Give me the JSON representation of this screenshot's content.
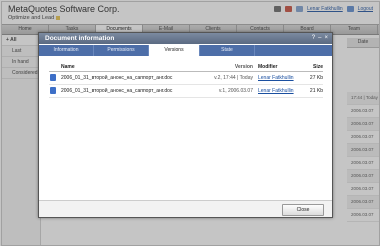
{
  "header": {
    "app_title": "MetaQuotes Software Corp.",
    "subtitle": "Optimize and Lead",
    "user_link": "Lenar Fatkhullin",
    "logout_link": "Logout"
  },
  "tabs": [
    "Home",
    "Tasks",
    "Documents",
    "E-Mail",
    "Clients",
    "Contacts",
    "Board",
    "Team"
  ],
  "active_tab": "Documents",
  "sidebar": {
    "items": [
      {
        "label": "All"
      },
      {
        "label": "Last"
      },
      {
        "label": "In hand"
      },
      {
        "label": "Considered"
      }
    ]
  },
  "background_list": {
    "column_header": "Date",
    "dates": [
      "17:44 | Today",
      "2006.03.07",
      "2006.03.07",
      "2006.03.07",
      "2006.03.07",
      "2006.03.07",
      "2006.03.07",
      "2006.03.07",
      "2006.03.07",
      "2006.03.07"
    ]
  },
  "modal": {
    "title": "Document information",
    "tabs": [
      "Information",
      "Permissions",
      "Versions",
      "State"
    ],
    "active_tab": "Versions",
    "columns": {
      "name": "Name",
      "version": "Version",
      "modifier": "Modifier",
      "size": "Size"
    },
    "rows": [
      {
        "name": "2006_01_31_второй_анонс_на_саппорт_анг.doc",
        "version": "v.2, 17:44 | Today",
        "modifier": "Lenar Fatkhullin",
        "size": "27 Kb"
      },
      {
        "name": "2006_01_31_второй_анонс_на_саппорт_анг.doc",
        "version": "v.1, 2006.03.07",
        "modifier": "Lenar Fatkhullin",
        "size": "21 Kb"
      }
    ],
    "close_button": "Close"
  }
}
